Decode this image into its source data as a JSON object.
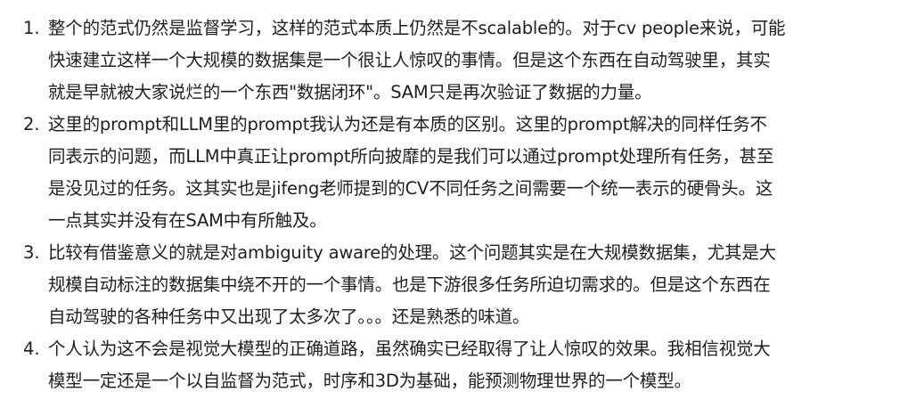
{
  "items": [
    {
      "number": "1.",
      "lines": [
        "整个的范式仍然是监督学习，这样的范式本质上仍然是不scalable的。对于cv people来说，可能",
        "快速建立这样一个大规模的数据集是一个很让人惊叹的事情。但是这个东西在自动驾驶里，其实",
        "就是早就被大家说烂的一个东西\"数据闭环\"。SAM只是再次验证了数据的力量。"
      ]
    },
    {
      "number": "2.",
      "lines": [
        "这里的prompt和LLM里的prompt我认为还是有本质的区别。这里的prompt解决的同样任务不",
        "同表示的问题，而LLM中真正让prompt所向披靡的是我们可以通过prompt处理所有任务，甚至",
        "是没见过的任务。这其实也是jifeng老师提到的CV不同任务之间需要一个统一表示的硬骨头。这",
        "一点其实并没有在SAM中有所触及。"
      ]
    },
    {
      "number": "3.",
      "lines": [
        "比较有借鉴意义的就是对ambiguity aware的处理。这个问题其实是在大规模数据集，尤其是大",
        "规模自动标注的数据集中绕不开的一个事情。也是下游很多任务所迫切需求的。但是这个东西在",
        "自动驾驶的各种任务中又出现了太多次了。。。还是熟悉的味道。"
      ]
    },
    {
      "number": "4.",
      "lines": [
        "个人认为这不会是视觉大模型的正确道路，虽然确实已经取得了让人惊叹的效果。我相信视觉大",
        "模型一定还是一个以自监督为范式，时序和3D为基础，能预测物理世界的一个模型。"
      ]
    }
  ]
}
